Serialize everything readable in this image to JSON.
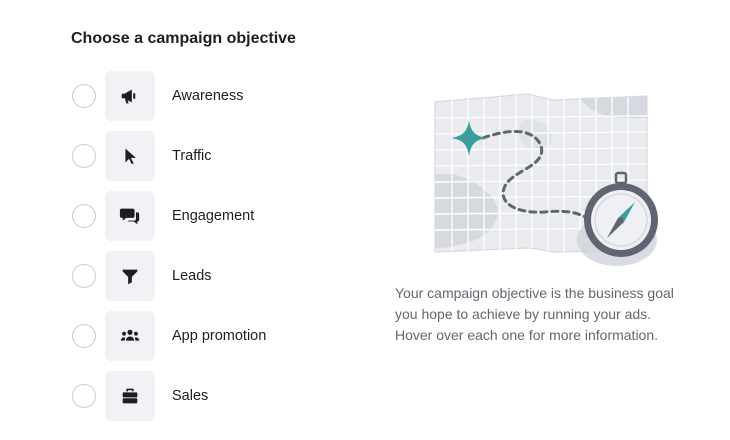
{
  "header": {
    "title": "Choose a campaign objective"
  },
  "objectives": [
    {
      "label": "Awareness",
      "icon": "megaphone-icon"
    },
    {
      "label": "Traffic",
      "icon": "cursor-icon"
    },
    {
      "label": "Engagement",
      "icon": "chat-bubbles-icon"
    },
    {
      "label": "Leads",
      "icon": "funnel-icon"
    },
    {
      "label": "App promotion",
      "icon": "people-icon"
    },
    {
      "label": "Sales",
      "icon": "briefcase-icon"
    }
  ],
  "info": {
    "description": "Your campaign objective is the business goal you hope to achieve by running your ads. Hover over each one for more information."
  },
  "colors": {
    "accent": "#3a9e9b",
    "tile_bg": "#f0f2f5",
    "icon": "#1c1e21"
  }
}
